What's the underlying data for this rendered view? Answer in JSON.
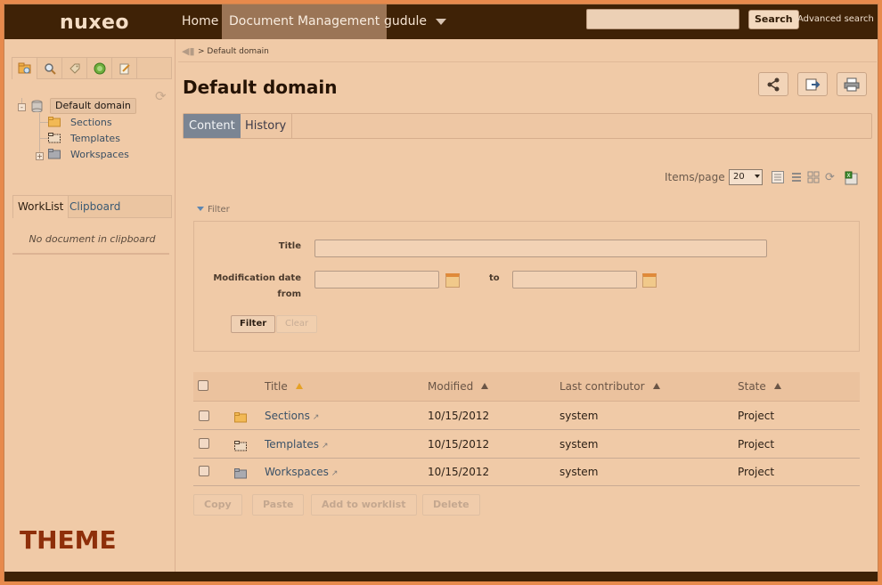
{
  "colors": {
    "topbar": "#3f2206",
    "active_nav": "#9b7556",
    "active_tab": "#7b8593",
    "accent_sort": "#e5a126",
    "theme_label": "#8e2f0a"
  },
  "header": {
    "logo": "nuxeo",
    "nav": {
      "home": "Home",
      "document_management": "Document Management",
      "user": "gudule"
    },
    "search": {
      "button": "Search",
      "advanced": "Advanced search",
      "value": ""
    }
  },
  "sidebar": {
    "tabs": [
      "navigation-icon",
      "search-icon",
      "tag-icon",
      "globe-icon",
      "edit-icon"
    ],
    "tree": {
      "root": "Default domain",
      "children": [
        "Sections",
        "Templates",
        "Workspaces"
      ]
    },
    "worklist_tabs": {
      "worklist": "WorkList",
      "clipboard": "Clipboard"
    },
    "clipboard_empty": "No document in clipboard",
    "theme_label": "THEME"
  },
  "main": {
    "breadcrumb": "> Default domain",
    "title": "Default domain",
    "tabs": {
      "content": "Content",
      "history": "History"
    },
    "items_per_page": {
      "label": "Items/page",
      "value": "20"
    },
    "filter": {
      "toggle": "Filter",
      "title_label": "Title",
      "mod_date_label_1": "Modification date",
      "mod_date_label_2": "from",
      "to_label": "to",
      "title_value": "",
      "from_value": "",
      "to_value": "",
      "filter_button": "Filter",
      "clear_button": "Clear"
    },
    "table": {
      "headers": {
        "title": "Title",
        "modified": "Modified",
        "contributor": "Last contributor",
        "state": "State"
      },
      "rows": [
        {
          "title": "Sections",
          "modified": "10/15/2012",
          "contributor": "system",
          "state": "Project",
          "icon": "folder-open-icon"
        },
        {
          "title": "Templates",
          "modified": "10/15/2012",
          "contributor": "system",
          "state": "Project",
          "icon": "folder-template-icon"
        },
        {
          "title": "Workspaces",
          "modified": "10/15/2012",
          "contributor": "system",
          "state": "Project",
          "icon": "folder-workspace-icon"
        }
      ]
    },
    "actions": {
      "copy": "Copy",
      "paste": "Paste",
      "add_to_worklist": "Add to worklist",
      "delete": "Delete"
    }
  }
}
